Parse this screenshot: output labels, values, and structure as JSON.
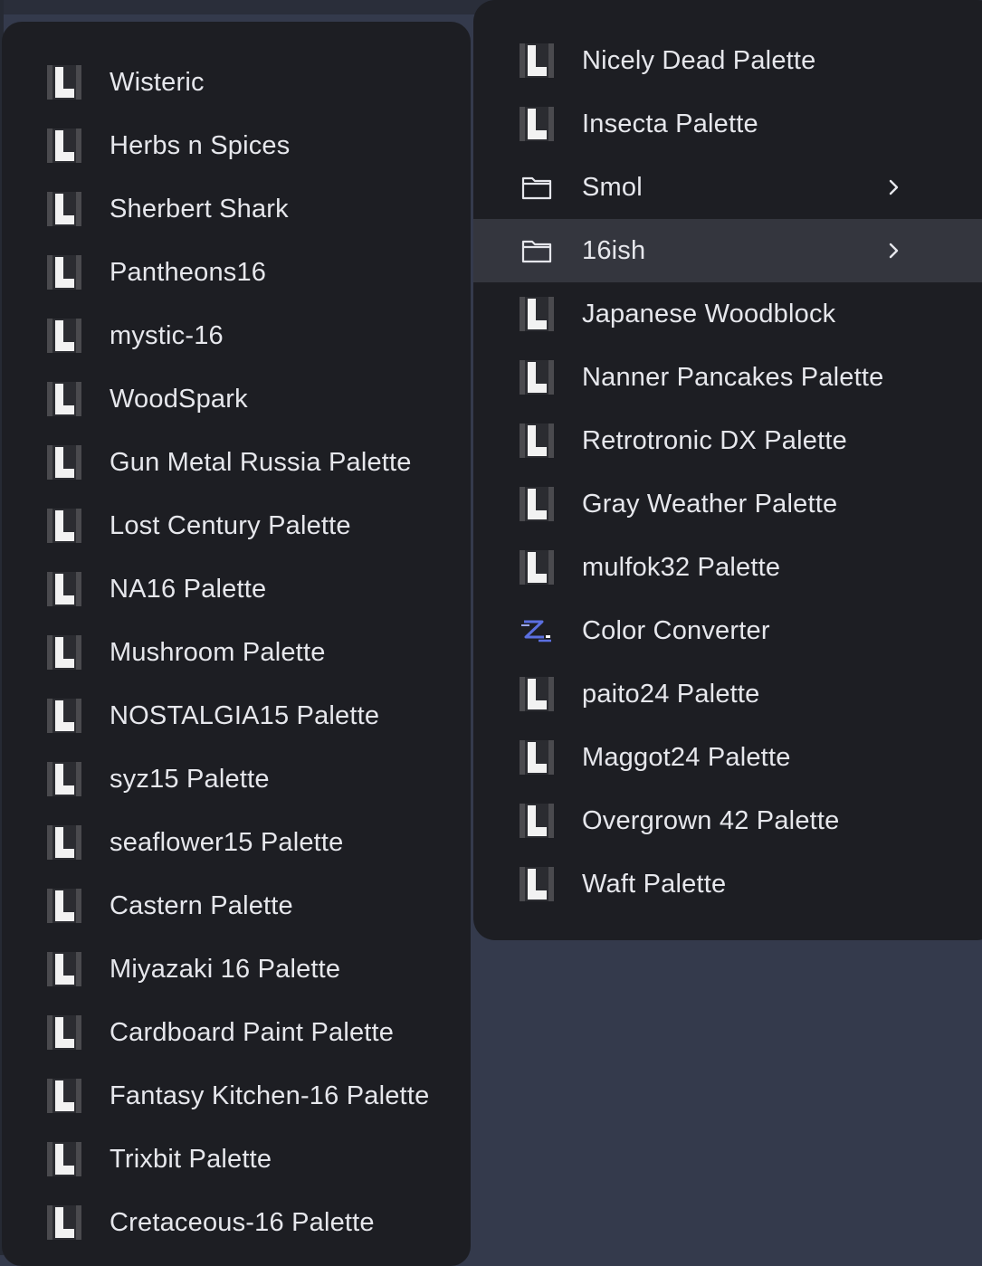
{
  "colors": {
    "background": "#343a4c",
    "menu_background": "#1d1e23",
    "highlight": "#34363e",
    "text": "#e6e7ec",
    "icon_white": "#f2f2f2",
    "icon_shadow": "#4a4a4e",
    "converter_icon": "#5b6fe0"
  },
  "left_menu": {
    "items": [
      {
        "label": "Wisteric",
        "icon": "palette-icon"
      },
      {
        "label": "Herbs n Spices",
        "icon": "palette-icon"
      },
      {
        "label": "Sherbert Shark",
        "icon": "palette-icon"
      },
      {
        "label": "Pantheons16",
        "icon": "palette-icon"
      },
      {
        "label": "mystic-16",
        "icon": "palette-icon"
      },
      {
        "label": "WoodSpark",
        "icon": "palette-icon"
      },
      {
        "label": "Gun Metal Russia Palette",
        "icon": "palette-icon"
      },
      {
        "label": "Lost Century Palette",
        "icon": "palette-icon"
      },
      {
        "label": "NA16 Palette",
        "icon": "palette-icon"
      },
      {
        "label": "Mushroom Palette",
        "icon": "palette-icon"
      },
      {
        "label": "NOSTALGIA15 Palette",
        "icon": "palette-icon"
      },
      {
        "label": "syz15 Palette",
        "icon": "palette-icon"
      },
      {
        "label": "seaflower15 Palette",
        "icon": "palette-icon"
      },
      {
        "label": "Castern Palette",
        "icon": "palette-icon"
      },
      {
        "label": "Miyazaki 16 Palette",
        "icon": "palette-icon"
      },
      {
        "label": "Cardboard Paint Palette",
        "icon": "palette-icon"
      },
      {
        "label": "Fantasy Kitchen-16 Palette",
        "icon": "palette-icon"
      },
      {
        "label": "Trixbit Palette",
        "icon": "palette-icon"
      },
      {
        "label": "Cretaceous-16 Palette",
        "icon": "palette-icon"
      }
    ]
  },
  "right_menu": {
    "items": [
      {
        "label": "Nicely Dead Palette",
        "icon": "palette-icon"
      },
      {
        "label": "Insecta Palette",
        "icon": "palette-icon"
      },
      {
        "label": "Smol",
        "icon": "folder-icon",
        "submenu": true
      },
      {
        "label": "16ish",
        "icon": "folder-icon",
        "submenu": true,
        "highlighted": true
      },
      {
        "label": "Japanese Woodblock",
        "icon": "palette-icon"
      },
      {
        "label": "Nanner Pancakes Palette",
        "icon": "palette-icon"
      },
      {
        "label": "Retrotronic DX Palette",
        "icon": "palette-icon"
      },
      {
        "label": "Gray Weather Palette",
        "icon": "palette-icon"
      },
      {
        "label": "mulfok32 Palette",
        "icon": "palette-icon"
      },
      {
        "label": "Color Converter",
        "icon": "color-converter-icon"
      },
      {
        "label": "paito24 Palette",
        "icon": "palette-icon"
      },
      {
        "label": "Maggot24 Palette",
        "icon": "palette-icon"
      },
      {
        "label": "Overgrown 42 Palette",
        "icon": "palette-icon"
      },
      {
        "label": "Waft Palette",
        "icon": "palette-icon"
      }
    ]
  }
}
